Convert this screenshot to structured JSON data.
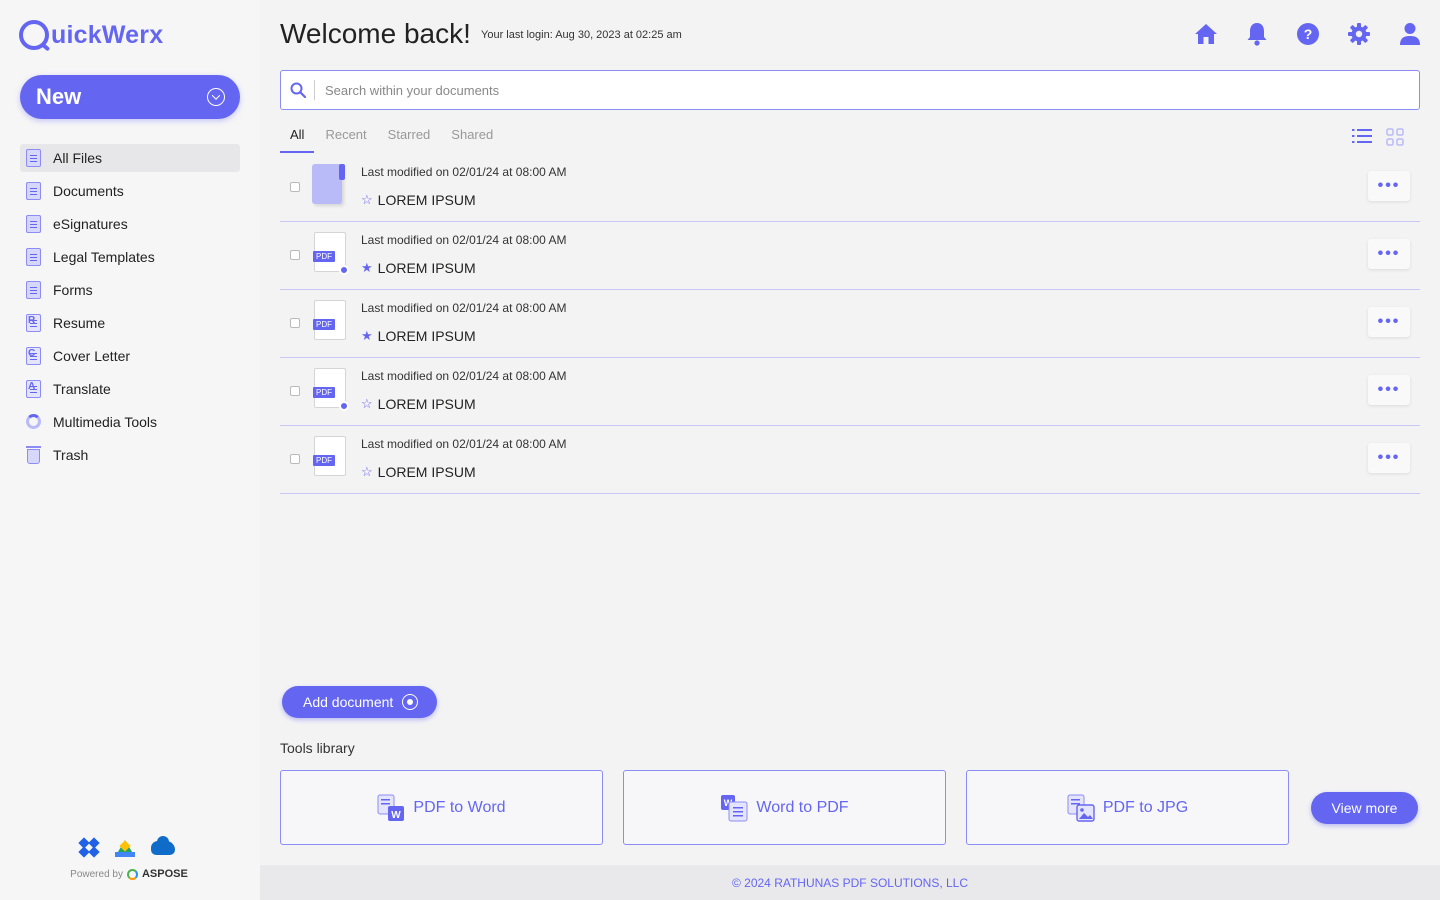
{
  "brand": {
    "logo_text": "uickWerx",
    "accent": "#6466f1"
  },
  "sidebar": {
    "new_label": "New",
    "items": [
      {
        "label": "All Files",
        "icon": "document-icon"
      },
      {
        "label": "Documents",
        "icon": "document-icon"
      },
      {
        "label": "eSignatures",
        "icon": "signature-icon"
      },
      {
        "label": "Legal Templates",
        "icon": "legal-template-icon"
      },
      {
        "label": "Forms",
        "icon": "form-icon"
      },
      {
        "label": "Resume",
        "icon": "resume-icon"
      },
      {
        "label": "Cover Letter",
        "icon": "cover-letter-icon"
      },
      {
        "label": "Translate",
        "icon": "translate-icon"
      },
      {
        "label": "Multimedia Tools",
        "icon": "multimedia-icon"
      },
      {
        "label": "Trash",
        "icon": "trash-icon"
      }
    ],
    "powered_by": "Powered by",
    "powered_brand": "ASPOSE"
  },
  "header": {
    "title": "Welcome back!",
    "last_login": "Your last login: Aug 30, 2023 at 02:25 am"
  },
  "search": {
    "placeholder": "Search within your documents"
  },
  "tabs": [
    "All",
    "Recent",
    "Starred",
    "Shared"
  ],
  "files": [
    {
      "modified": "Last modified on 02/01/24 at 08:00 AM",
      "name": "LOREM IPSUM",
      "type": "folder",
      "starred": false
    },
    {
      "modified": "Last modified on 02/01/24 at 08:00 AM",
      "name": "LOREM IPSUM",
      "type": "pdf",
      "starred": true
    },
    {
      "modified": "Last modified on 02/01/24 at 08:00 AM",
      "name": "LOREM IPSUM",
      "type": "pdf",
      "starred": true
    },
    {
      "modified": "Last modified on 02/01/24 at 08:00 AM",
      "name": "LOREM IPSUM",
      "type": "pdf",
      "starred": false
    },
    {
      "modified": "Last modified on 02/01/24 at 08:00 AM",
      "name": "LOREM IPSUM",
      "type": "pdf",
      "starred": false
    }
  ],
  "pdf_tag": "PDF",
  "more_label": "•••",
  "add_document_label": "Add document",
  "tools": {
    "title": "Tools library",
    "items": [
      "PDF to Word",
      "Word to PDF",
      "PDF to JPG"
    ],
    "view_more": "View more"
  },
  "footer": {
    "text": "© 2024 RATHUNAS PDF SOLUTIONS, LLC"
  }
}
